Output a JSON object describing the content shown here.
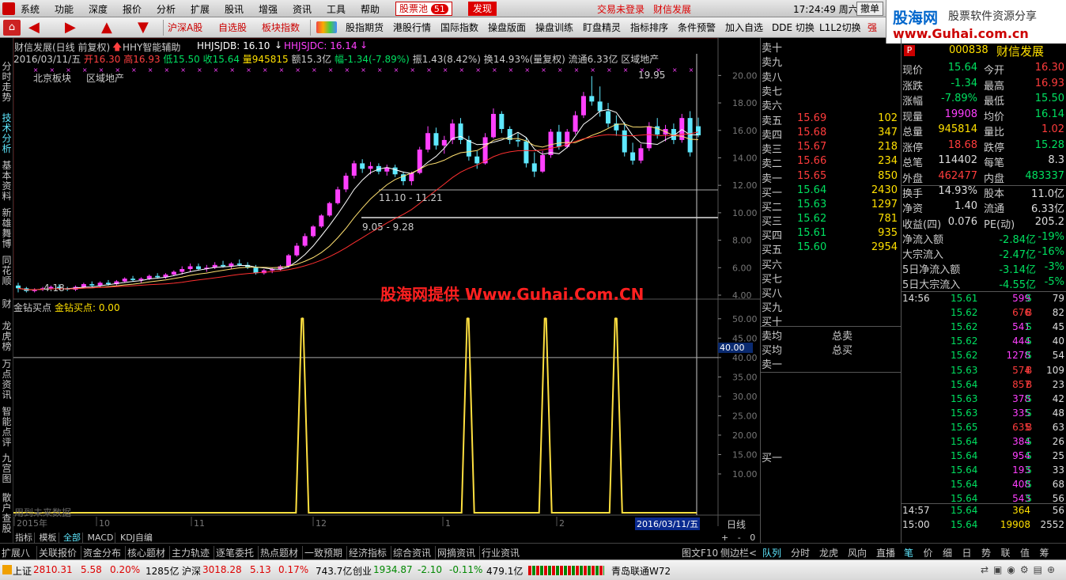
{
  "menu": {
    "items": [
      "系统",
      "功能",
      "深度",
      "报价",
      "分析",
      "扩展",
      "股讯",
      "增强",
      "资讯",
      "工具",
      "帮助"
    ],
    "stock_pool": "股票池",
    "stock_pool_count": "51",
    "discover": "发现",
    "trade_status": "交易未登录",
    "trade_status2": "财信发展",
    "clock": "17:24:49 周六",
    "cancel": "撤单"
  },
  "brand": {
    "logo": "股海网",
    "tagline": "股票软件资源分享",
    "url": "www.Guhai.com.cn"
  },
  "toolbar": {
    "items": [
      "沪深A股",
      "自选股",
      "板块指数",
      "股指期货",
      "港股行情",
      "国际指数",
      "操盘版面",
      "操盘训练",
      "盯盘精灵",
      "指标排序",
      "条件预警",
      "加入自选",
      "DDE 切换",
      "L1L2切换"
    ]
  },
  "lefttabs": [
    "分时走势",
    "技术分析",
    "基本资料",
    "新雄舞博",
    "同花顺",
    "财",
    "龙虎榜",
    "万点资讯",
    "智能点评",
    "九宫图",
    "散户查股"
  ],
  "chart": {
    "header1": "财信发展(日线 前复权)",
    "indicator_name": "HHY智能辅助",
    "hhjsjdb": "HHJSJDB: 16.10",
    "hhjsjdc": "HHJSJDC: 16.14",
    "info_date": "2016/03/11/五",
    "info_open": "开16.30",
    "info_high": "高16.93",
    "info_low": "低15.50",
    "info_close": "收15.64",
    "info_vol": "量945815",
    "info_amt": "额15.3亿",
    "info_pct": "幅-1.34(-7.89%)",
    "info_rest": "振1.43(8.42%) 换14.93%(量复权) 流通6.33亿 区域地产",
    "block1": "北京板块",
    "block2": "区域地产",
    "label_high": "19.95",
    "label_low": "4.18",
    "label_range1": "11.10 - 11.21",
    "label_range2": "9.05 - 9.28",
    "watermark": "股海网提供 Www.Guhai.Com.CN",
    "sub_title": "金钻买点",
    "sub_value": "金钻买点: 0.00",
    "future_note": "用到未来数据",
    "sub_level": "40.00",
    "price_ticks": [
      "20.00",
      "18.00",
      "16.00",
      "14.00",
      "12.00",
      "10.00",
      "8.00",
      "6.00",
      "4.00"
    ],
    "sub_ticks": [
      "50.00",
      "45.00",
      "40.00",
      "35.00",
      "30.00",
      "25.00",
      "20.00",
      "15.00",
      "10.00"
    ],
    "x_labels": [
      "2015年",
      "10",
      "11",
      "12",
      "1",
      "2"
    ],
    "cursor_date": "2016/03/11/五",
    "period": "日线",
    "zoom_controls": [
      "+",
      "-",
      "0"
    ],
    "tabs": [
      "指标",
      "模板",
      "全部",
      "MACD",
      "KDJ自编"
    ]
  },
  "chart_data": {
    "type": "candlestick",
    "ylim": [
      4,
      21
    ],
    "candles": [
      [
        4.7,
        4.9,
        4.2,
        4.5
      ],
      [
        4.5,
        4.6,
        4.2,
        4.3
      ],
      [
        4.3,
        4.5,
        4.2,
        4.4
      ],
      [
        4.4,
        4.6,
        4.3,
        4.5
      ],
      [
        4.5,
        4.7,
        4.4,
        4.6
      ],
      [
        4.6,
        4.8,
        4.4,
        4.5
      ],
      [
        4.5,
        4.6,
        4.3,
        4.4
      ],
      [
        4.4,
        4.7,
        4.3,
        4.6
      ],
      [
        4.6,
        4.9,
        4.5,
        4.8
      ],
      [
        4.8,
        5.0,
        4.6,
        4.7
      ],
      [
        4.7,
        5.0,
        4.6,
        4.9
      ],
      [
        4.9,
        5.1,
        4.7,
        4.8
      ],
      [
        4.8,
        5.1,
        4.7,
        5.0
      ],
      [
        5.0,
        5.3,
        4.9,
        5.2
      ],
      [
        5.2,
        5.4,
        5.0,
        5.1
      ],
      [
        5.1,
        5.3,
        4.9,
        5.2
      ],
      [
        5.2,
        5.5,
        5.1,
        5.4
      ],
      [
        5.4,
        5.6,
        5.2,
        5.3
      ],
      [
        5.3,
        5.6,
        5.2,
        5.5
      ],
      [
        5.5,
        5.8,
        5.4,
        5.7
      ],
      [
        5.7,
        6.1,
        5.5,
        5.9
      ],
      [
        5.9,
        6.3,
        5.7,
        6.1
      ],
      [
        6.1,
        6.3,
        5.8,
        5.9
      ],
      [
        5.9,
        6.2,
        5.7,
        6.0
      ],
      [
        6.0,
        6.4,
        5.9,
        6.2
      ],
      [
        6.2,
        6.5,
        6.0,
        6.1
      ],
      [
        6.1,
        6.4,
        5.9,
        6.3
      ],
      [
        6.3,
        6.6,
        6.1,
        6.2
      ],
      [
        6.2,
        6.4,
        5.9,
        6.0
      ],
      [
        6.0,
        6.2,
        5.5,
        5.6
      ],
      [
        5.6,
        5.9,
        5.5,
        5.8
      ],
      [
        5.8,
        6.0,
        5.6,
        5.9
      ],
      [
        5.9,
        6.2,
        5.8,
        6.1
      ],
      [
        6.1,
        7.0,
        6.0,
        6.9
      ],
      [
        6.9,
        7.8,
        6.8,
        7.6
      ],
      [
        7.6,
        8.5,
        7.5,
        8.3
      ],
      [
        8.3,
        9.1,
        8.2,
        9.0
      ],
      [
        9.0,
        9.9,
        8.9,
        9.8
      ],
      [
        9.8,
        10.8,
        9.7,
        10.7
      ],
      [
        10.7,
        11.9,
        10.6,
        11.7
      ],
      [
        11.7,
        12.9,
        11.5,
        12.7
      ],
      [
        12.7,
        13.8,
        12.5,
        13.6
      ],
      [
        13.6,
        13.9,
        12.9,
        13.2
      ],
      [
        13.2,
        13.7,
        12.8,
        13.4
      ],
      [
        13.4,
        13.6,
        12.8,
        13.0
      ],
      [
        13.0,
        13.5,
        12.7,
        13.3
      ],
      [
        13.3,
        13.5,
        12.6,
        12.8
      ],
      [
        12.8,
        13.0,
        12.0,
        12.3
      ],
      [
        12.3,
        13.0,
        12.0,
        12.9
      ],
      [
        12.9,
        14.8,
        12.8,
        14.6
      ],
      [
        14.6,
        16.3,
        14.4,
        15.8
      ],
      [
        15.8,
        16.2,
        14.6,
        14.9
      ],
      [
        14.9,
        15.6,
        14.3,
        15.3
      ],
      [
        15.3,
        16.8,
        15.0,
        16.5
      ],
      [
        16.5,
        16.9,
        15.0,
        15.3
      ],
      [
        15.3,
        15.6,
        13.8,
        14.1
      ],
      [
        14.1,
        14.5,
        13.2,
        13.6
      ],
      [
        13.6,
        15.8,
        13.5,
        15.5
      ],
      [
        15.5,
        17.6,
        15.4,
        17.2
      ],
      [
        17.2,
        17.4,
        15.8,
        16.1
      ],
      [
        16.1,
        16.3,
        15.0,
        15.3
      ],
      [
        15.3,
        15.8,
        14.8,
        15.2
      ],
      [
        15.2,
        15.5,
        13.3,
        13.6
      ],
      [
        13.6,
        14.4,
        12.6,
        13.0
      ],
      [
        13.0,
        14.5,
        12.9,
        14.2
      ],
      [
        14.2,
        16.1,
        14.0,
        15.9
      ],
      [
        15.9,
        16.4,
        14.6,
        14.8
      ],
      [
        14.8,
        16.1,
        14.7,
        15.9
      ],
      [
        15.9,
        17.4,
        15.7,
        17.1
      ],
      [
        17.1,
        18.8,
        16.9,
        18.5
      ],
      [
        18.5,
        19.95,
        17.8,
        18.1
      ],
      [
        18.1,
        19.2,
        17.0,
        17.4
      ],
      [
        17.4,
        18.0,
        16.2,
        16.5
      ],
      [
        16.5,
        17.1,
        15.6,
        16.0
      ],
      [
        16.0,
        16.6,
        14.1,
        14.4
      ],
      [
        14.4,
        15.1,
        13.5,
        13.8
      ],
      [
        13.8,
        15.0,
        13.6,
        14.7
      ],
      [
        14.7,
        16.6,
        14.5,
        16.3
      ],
      [
        16.3,
        16.9,
        15.4,
        15.7
      ],
      [
        15.7,
        16.4,
        15.2,
        16.1
      ],
      [
        16.1,
        16.5,
        15.0,
        15.3
      ],
      [
        15.3,
        17.2,
        15.1,
        16.9
      ],
      [
        16.9,
        17.4,
        14.1,
        14.4
      ],
      [
        16.3,
        16.93,
        15.5,
        15.64
      ]
    ],
    "signal": [
      0,
      0,
      0,
      0,
      0,
      0,
      0,
      0,
      0,
      0,
      0,
      0,
      0,
      0,
      0,
      0,
      0,
      0,
      0,
      0,
      0,
      0,
      0,
      0,
      0,
      0,
      0,
      0,
      0,
      0,
      0,
      0,
      0,
      0,
      0,
      0,
      0,
      0,
      0,
      0,
      0,
      0,
      0,
      0,
      0,
      0,
      0,
      0,
      0,
      0,
      0,
      0,
      0,
      0,
      0,
      0,
      0,
      0,
      0,
      0,
      0,
      0,
      0,
      0,
      0,
      0,
      0,
      0,
      0,
      0,
      0,
      0,
      0,
      0,
      0,
      0,
      0,
      0,
      0,
      0,
      0,
      0,
      0,
      0,
      0
    ],
    "signal_peaks": [
      0.41,
      0.645,
      0.755,
      0.855
    ],
    "sub_ylim": [
      0,
      52
    ]
  },
  "orderbook": {
    "asks": [
      {
        "l": "卖十",
        "p": "",
        "v": ""
      },
      {
        "l": "卖九",
        "p": "",
        "v": ""
      },
      {
        "l": "卖八",
        "p": "",
        "v": ""
      },
      {
        "l": "卖七",
        "p": "",
        "v": ""
      },
      {
        "l": "卖六",
        "p": "",
        "v": ""
      },
      {
        "l": "卖五",
        "p": "15.69",
        "v": "102"
      },
      {
        "l": "卖四",
        "p": "15.68",
        "v": "347"
      },
      {
        "l": "卖三",
        "p": "15.67",
        "v": "218"
      },
      {
        "l": "卖二",
        "p": "15.66",
        "v": "234"
      },
      {
        "l": "卖一",
        "p": "15.65",
        "v": "850"
      }
    ],
    "bids": [
      {
        "l": "买一",
        "p": "15.64",
        "v": "2430"
      },
      {
        "l": "买二",
        "p": "15.63",
        "v": "1297"
      },
      {
        "l": "买三",
        "p": "15.62",
        "v": "781"
      },
      {
        "l": "买四",
        "p": "15.61",
        "v": "935"
      },
      {
        "l": "买五",
        "p": "15.60",
        "v": "2954"
      },
      {
        "l": "买六",
        "p": "",
        "v": ""
      },
      {
        "l": "买七",
        "p": "",
        "v": ""
      },
      {
        "l": "买八",
        "p": "",
        "v": ""
      },
      {
        "l": "买九",
        "p": "",
        "v": ""
      },
      {
        "l": "买十",
        "p": "",
        "v": ""
      }
    ],
    "avg_sell": "卖均",
    "avg_buy": "买均",
    "total_sell": "总卖",
    "total_buy": "总买",
    "sell1b": "卖一",
    "buy1b": "买一"
  },
  "quote": {
    "code": "000838",
    "name": "财信发展",
    "market": "P",
    "rows": [
      [
        "现价",
        "15.64",
        "g",
        "今开",
        "16.30",
        "r"
      ],
      [
        "涨跌",
        "-1.34",
        "g",
        "最高",
        "16.93",
        "r"
      ],
      [
        "涨幅",
        "-7.89%",
        "g",
        "最低",
        "15.50",
        "g"
      ],
      [
        "现量",
        "19908",
        "m",
        "均价",
        "16.14",
        "g"
      ],
      [
        "总量",
        "945814",
        "y",
        "量比",
        "1.02",
        "r"
      ],
      [
        "涨停",
        "18.68",
        "r",
        "跌停",
        "15.28",
        "g"
      ],
      [
        "总笔",
        "114402",
        "w",
        "每笔",
        "8.3",
        "w"
      ],
      [
        "外盘",
        "462477",
        "r",
        "内盘",
        "483337",
        "g"
      ]
    ],
    "rows2": [
      [
        "换手",
        "14.93%",
        "w",
        "股本",
        "11.0亿",
        "w"
      ],
      [
        "净资",
        "1.40",
        "w",
        "流通",
        "6.33亿",
        "w"
      ],
      [
        "收益(四)",
        "0.076",
        "w",
        "PE(动)",
        "205.2",
        "w"
      ]
    ],
    "flows": [
      [
        "净流入额",
        "-2.84亿",
        "-19%"
      ],
      [
        "大宗流入",
        "-2.47亿",
        "-16%"
      ],
      [
        "5日净流入额",
        "-3.14亿",
        "-3%"
      ],
      [
        "5日大宗流入",
        "-4.55亿",
        "-5%"
      ]
    ],
    "ticks": [
      [
        "14:56",
        "15.61",
        "599",
        "S",
        "79"
      ],
      [
        "",
        "15.62",
        "676",
        "B",
        "82"
      ],
      [
        "",
        "15.62",
        "541",
        "S",
        "45"
      ],
      [
        "",
        "15.62",
        "444",
        "S",
        "40"
      ],
      [
        "",
        "15.62",
        "1278",
        "S",
        "54"
      ],
      [
        "",
        "15.63",
        "574",
        "B",
        "109"
      ],
      [
        "",
        "15.64",
        "857",
        "B",
        "23"
      ],
      [
        "",
        "15.63",
        "378",
        "S",
        "42"
      ],
      [
        "",
        "15.63",
        "335",
        "S",
        "48"
      ],
      [
        "",
        "15.65",
        "635",
        "B",
        "63"
      ],
      [
        "",
        "15.64",
        "384",
        "S",
        "26"
      ],
      [
        "",
        "15.64",
        "954",
        "S",
        "25"
      ],
      [
        "",
        "15.64",
        "193",
        "S",
        "33"
      ],
      [
        "",
        "15.64",
        "408",
        "S",
        "68"
      ],
      [
        "",
        "15.64",
        "543",
        "S",
        "56"
      ],
      [
        "14:57",
        "15.64",
        "364",
        "",
        "56"
      ],
      [
        "15:00",
        "15.64",
        "19908",
        "",
        "2552"
      ]
    ],
    "tabs": [
      "队列",
      "分时",
      "龙虎",
      "风向",
      "直播"
    ],
    "tabs2": [
      "笔",
      "价",
      "细",
      "日",
      "势",
      "联",
      "值",
      "筹"
    ]
  },
  "bottom_tabs": [
    "扩展八",
    "关联报价",
    "资金分布",
    "核心题材",
    "主力轨迹",
    "逐笔委托",
    "热点题材",
    "一致预期",
    "经济指标",
    "综合资讯",
    "网摘资讯",
    "行业资讯"
  ],
  "bottom_right": [
    "图文F10",
    "侧边栏<"
  ],
  "status": {
    "sh_name": "上证",
    "sh_val": "2810.31",
    "sh_chg": "5.58",
    "sh_pct": "0.20%",
    "sh_amt": "1285亿",
    "sz_name": "沪深",
    "sz_val": "3018.28",
    "sz_chg": "5.13",
    "sz_pct": "0.17%",
    "sz_amt": "743.7亿",
    "cy_name": "创业",
    "cy_val": "1934.87",
    "cy_chg": "-2.10",
    "cy_pct": "-0.11%",
    "cy_amt": "479.1亿",
    "server": "青岛联通W72"
  }
}
